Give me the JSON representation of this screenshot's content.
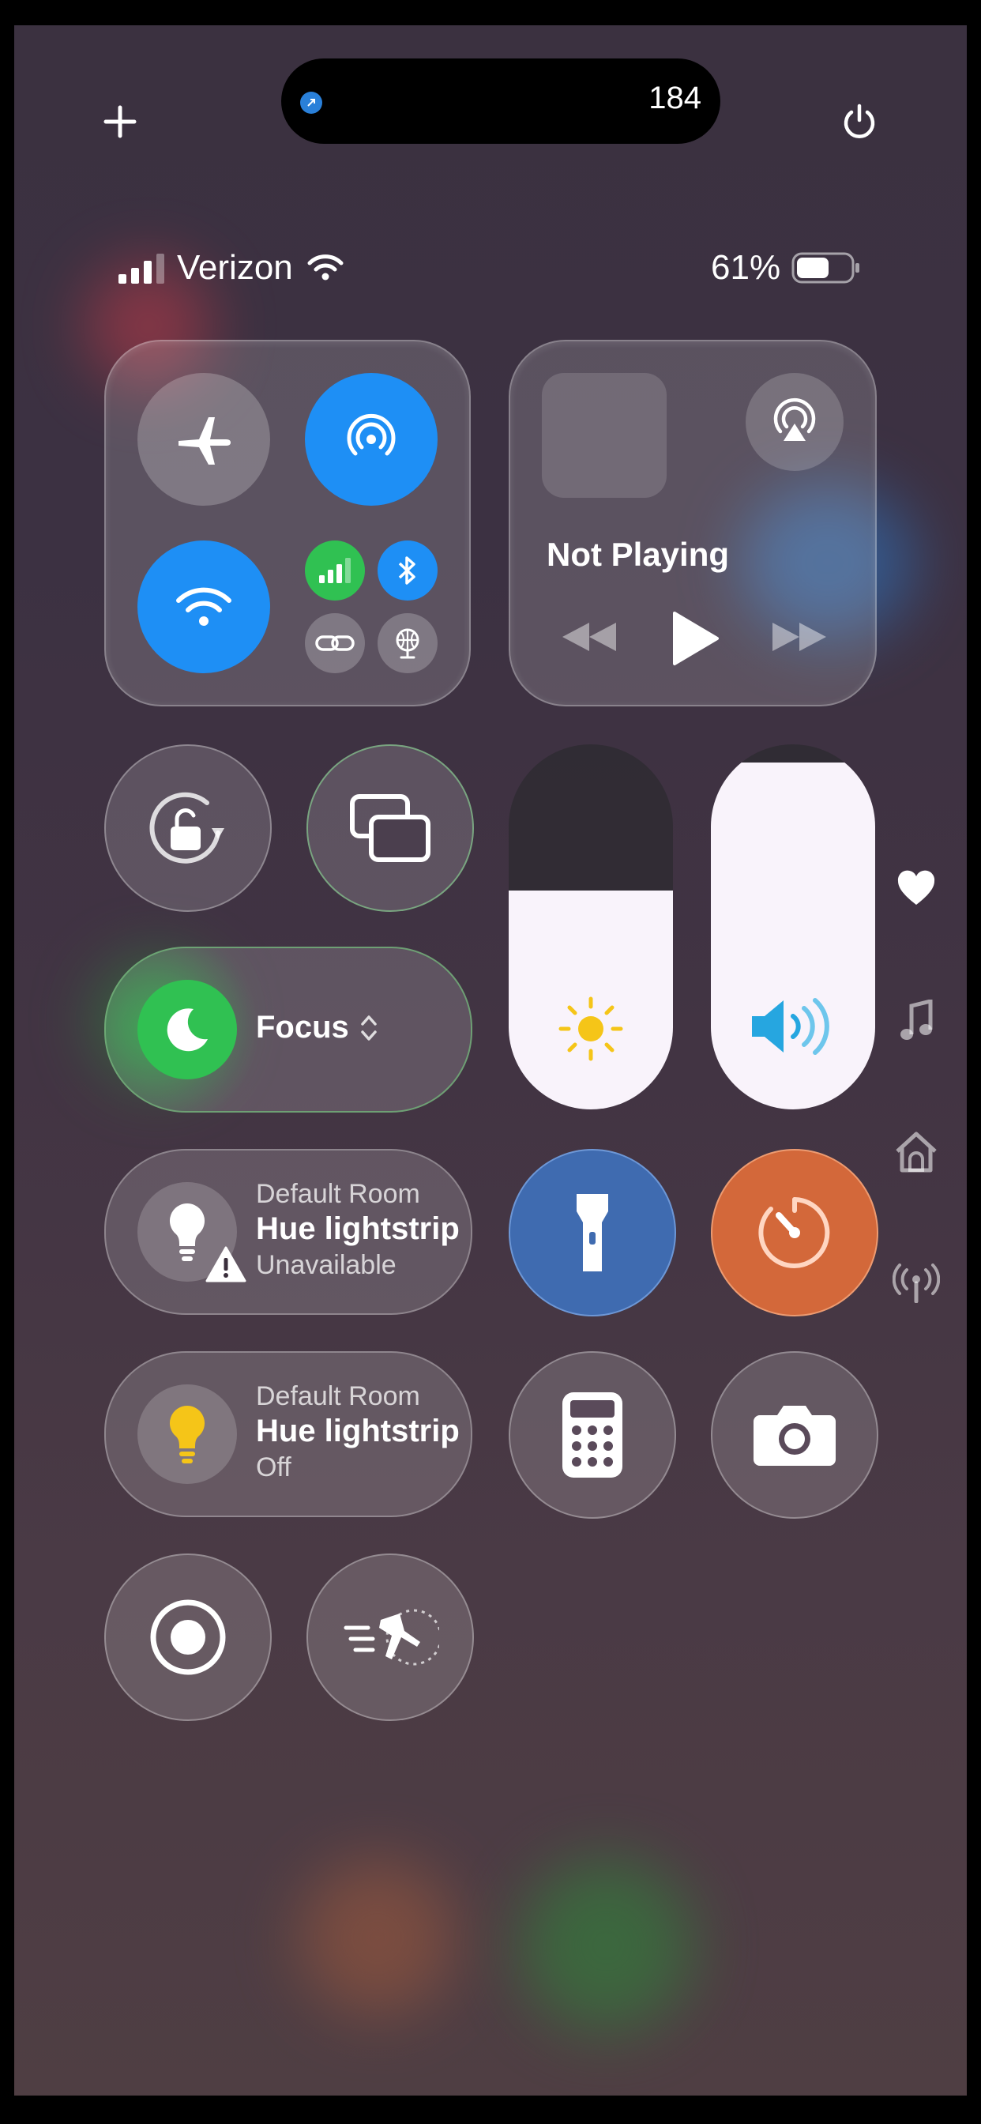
{
  "top_bar": {
    "activity_count": "184",
    "add_icon": "plus-icon",
    "power_icon": "power-icon"
  },
  "status_bar": {
    "carrier": "Verizon",
    "battery_percent": "61%",
    "battery_level": 0.61
  },
  "connectivity": {
    "airplane_mode": false,
    "airdrop_on": true,
    "wifi_on": true,
    "cellular_on": true,
    "bluetooth_on": true
  },
  "media": {
    "status": "Not Playing"
  },
  "sliders": {
    "brightness_level": 0.6,
    "volume_level": 0.95
  },
  "focus": {
    "label": "Focus"
  },
  "home_accessories": [
    {
      "room": "Default Room",
      "name": "Hue lightstrip",
      "status": "Unavailable"
    },
    {
      "room": "Default Room",
      "name": "Hue lightstrip",
      "status": "Off"
    }
  ],
  "colors": {
    "accent_blue": "#1e8ff5",
    "focus_green": "#30c152",
    "timer_orange": "#d3683a",
    "bulb_yellow": "#f5c518"
  },
  "side_nav": [
    "favorites-heart-icon",
    "music-note-icon",
    "home-icon",
    "connectivity-antenna-icon"
  ]
}
